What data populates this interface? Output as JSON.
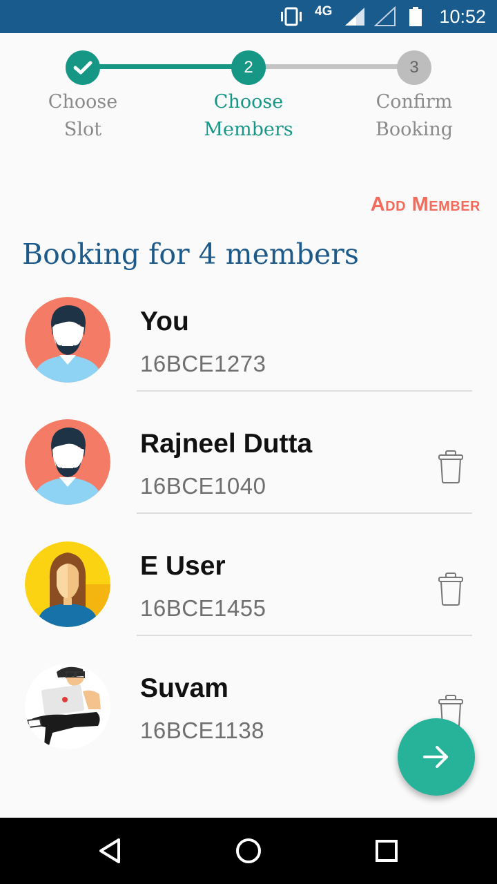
{
  "status_bar": {
    "network": "4G",
    "time": "10:52",
    "icons": [
      "vibrate-icon",
      "signal-icon",
      "signal-empty-icon",
      "battery-icon"
    ]
  },
  "stepper": {
    "steps": [
      {
        "number": "1",
        "label_line1": "Choose",
        "label_line2": "Slot",
        "state": "completed"
      },
      {
        "number": "2",
        "label_line1": "Choose",
        "label_line2": "Members",
        "state": "active"
      },
      {
        "number": "3",
        "label_line1": "Confirm",
        "label_line2": "Booking",
        "state": "pending"
      }
    ],
    "colors": {
      "active": "#169685",
      "pending": "#bdbdbd",
      "label_pending": "#8a8a8a"
    }
  },
  "add_member_label": "Add Member",
  "section_title": "Booking for 4 members",
  "members": [
    {
      "name": "You",
      "id": "16BCE1273",
      "avatar": "male-avatar-icon",
      "deletable": false
    },
    {
      "name": "Rajneel Dutta",
      "id": "16BCE1040",
      "avatar": "male-avatar-icon",
      "deletable": true
    },
    {
      "name": "E User",
      "id": "16BCE1455",
      "avatar": "female-avatar-icon",
      "deletable": true
    },
    {
      "name": "Suvam",
      "id": "16BCE1138",
      "avatar": "laptop-user-avatar-icon",
      "deletable": true
    }
  ],
  "fab": {
    "icon": "arrow-right-icon",
    "color": "#26b39a"
  },
  "nav_bar": {
    "buttons": [
      "back-icon",
      "home-icon",
      "recents-icon"
    ]
  }
}
